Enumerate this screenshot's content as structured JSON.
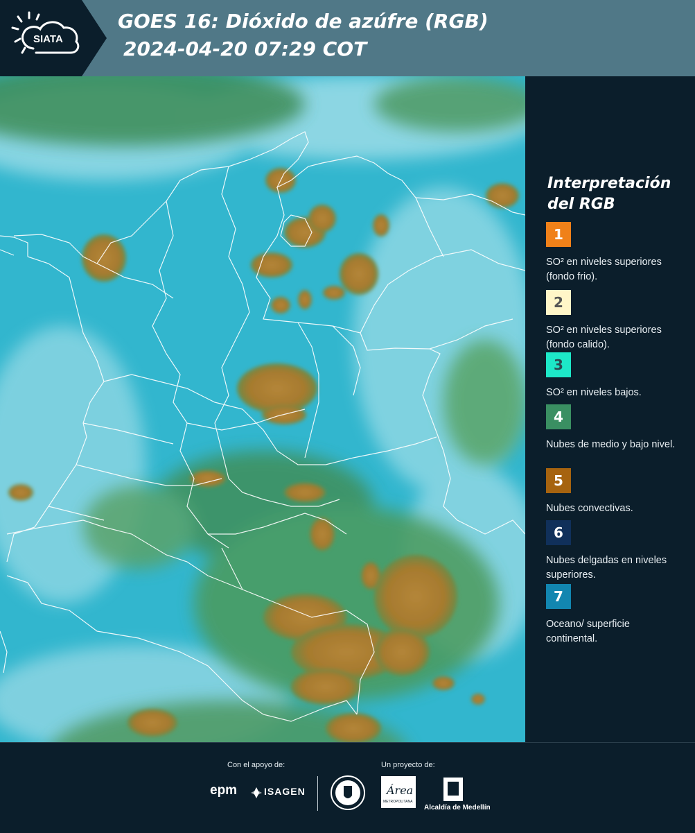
{
  "header": {
    "logo_text": "SIATA",
    "title_line1": "GOES 16: Dióxido de azúfre (RGB)",
    "title_line2": "2024-04-20 07:29 COT"
  },
  "legend": {
    "title": "Interpretación del RGB",
    "items": [
      {
        "number": "1",
        "color": "#f08119",
        "text_color": "#ffffff",
        "label": "SO² en niveles superiores (fondo frio)."
      },
      {
        "number": "2",
        "color": "#fff6c8",
        "text_color": "#555555",
        "label": "SO² en niveles superiores (fondo calido)."
      },
      {
        "number": "3",
        "color": "#1de8c8",
        "text_color": "#2b4a52",
        "label": "SO² en niveles bajos."
      },
      {
        "number": "4",
        "color": "#3a8f62",
        "text_color": "#ffffff",
        "label": "Nubes de medio y bajo nivel."
      },
      {
        "number": "5",
        "color": "#a6630f",
        "text_color": "#ffffff",
        "label": "Nubes convectivas."
      },
      {
        "number": "6",
        "color": "#10305a",
        "text_color": "#ffffff",
        "label": "Nubes delgadas en niveles superiores."
      },
      {
        "number": "7",
        "color": "#1286b0",
        "text_color": "#ffffff",
        "label": "Oceano/ superficie continental."
      }
    ]
  },
  "footer": {
    "sponsor_caption": "Con el apoyo de:",
    "project_caption": "Un proyecto de:",
    "sponsor_1": "epm",
    "sponsor_2": "ISAGEN",
    "partner_1": "Área",
    "partner_1_sub": "METROPOLITANA",
    "partner_2": "Alcaldía de Medellín"
  },
  "colors": {
    "ocean_cyan": "#34b8cf",
    "convective": "#a87a2a",
    "mid_low": "#3c8d55",
    "boundary": "#ffffff"
  }
}
